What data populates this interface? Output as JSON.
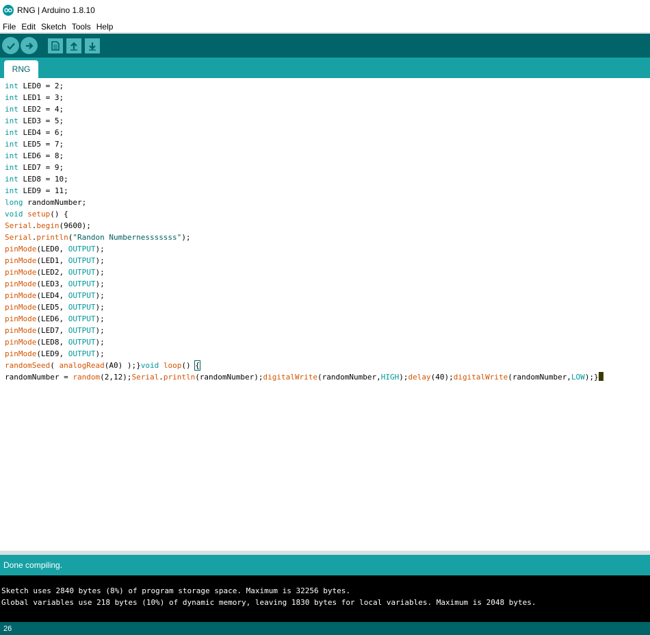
{
  "window": {
    "title": "RNG | Arduino 1.8.10"
  },
  "menu": [
    "File",
    "Edit",
    "Sketch",
    "Tools",
    "Help"
  ],
  "toolbar": {
    "buttons": [
      "check-icon",
      "arrow-right-icon",
      "new-file-icon",
      "open-arrow-up-icon",
      "save-arrow-down-icon"
    ]
  },
  "tabs": [
    {
      "label": "RNG"
    }
  ],
  "colors": {
    "toolbar": "#006468",
    "tabbar": "#17a1a5",
    "keyword": "#00979c",
    "function": "#d35400",
    "console_bg": "#000000"
  },
  "code": [
    "int LED0 = 2;",
    "int LED1 = 3;",
    "int LED2 = 4;",
    "int LED3 = 5;",
    "int LED4 = 6;",
    "int LED5 = 7;",
    "int LED6 = 8;",
    "int LED7 = 9;",
    "int LED8 = 10;",
    "int LED9 = 11;",
    "long randomNumber;",
    "void setup() {",
    "Serial.begin(9600);",
    "Serial.println(\"Randon Numbernesssssss\");",
    "pinMode(LED0, OUTPUT);",
    "pinMode(LED1, OUTPUT);",
    "pinMode(LED2, OUTPUT);",
    "pinMode(LED3, OUTPUT);",
    "pinMode(LED4, OUTPUT);",
    "pinMode(LED5, OUTPUT);",
    "pinMode(LED6, OUTPUT);",
    "pinMode(LED7, OUTPUT);",
    "pinMode(LED8, OUTPUT);",
    "pinMode(LED9, OUTPUT);",
    "randomSeed( analogRead(A0) );}void loop() {",
    "randomNumber = random(2,12);Serial.println(randomNumber);digitalWrite(randomNumber,HIGH);delay(40);digitalWrite(randomNumber,LOW);}"
  ],
  "status": {
    "message": "Done compiling."
  },
  "console": [
    "Sketch uses 2840 bytes (8%) of program storage space. Maximum is 32256 bytes.",
    "Global variables use 218 bytes (10%) of dynamic memory, leaving 1830 bytes for local variables. Maximum is 2048 bytes."
  ],
  "footer": {
    "line_number": "26"
  }
}
